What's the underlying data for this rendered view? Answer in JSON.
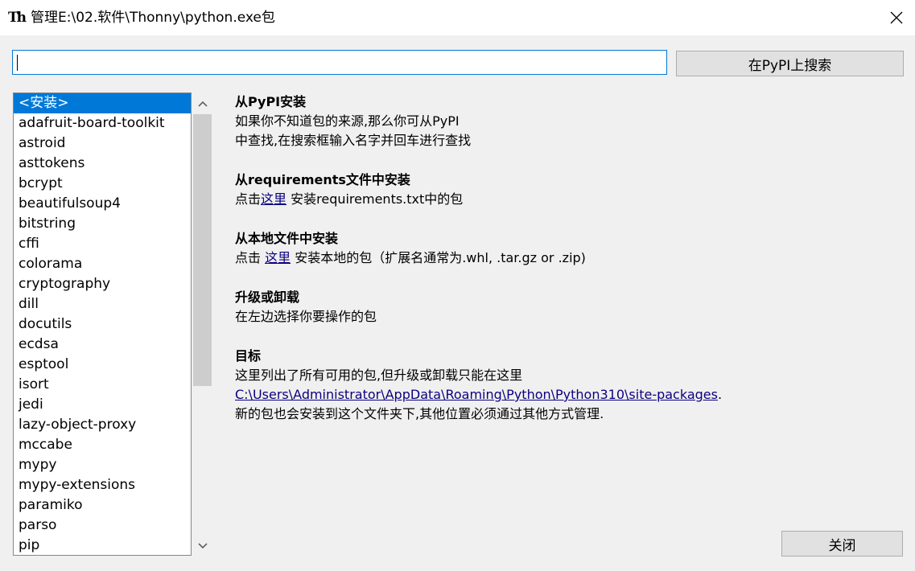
{
  "window": {
    "title": "管理E:\\02.软件\\Thonny\\python.exe包",
    "app_icon_text": "Th",
    "close_icon": "close-icon"
  },
  "search": {
    "value": "",
    "placeholder": "",
    "button_label": "在PyPI上搜索"
  },
  "packages": {
    "items": [
      "<安装>",
      "adafruit-board-toolkit",
      "astroid",
      "asttokens",
      "bcrypt",
      "beautifulsoup4",
      "bitstring",
      "cffi",
      "colorama",
      "cryptography",
      "dill",
      "docutils",
      "ecdsa",
      "esptool",
      "isort",
      "jedi",
      "lazy-object-proxy",
      "mccabe",
      "mypy",
      "mypy-extensions",
      "paramiko",
      "parso",
      "pip"
    ],
    "selected_index": 0
  },
  "info": {
    "pypi": {
      "title": "从PyPI安装",
      "line1": "如果你不知道包的来源,那么你可从PyPI",
      "line2": "中查找,在搜索框输入名字并回车进行查找"
    },
    "requirements": {
      "title": "从requirements文件中安装",
      "prefix": "点击",
      "link": "这里",
      "suffix": " 安装requirements.txt中的包"
    },
    "local": {
      "title": "从本地文件中安装",
      "prefix": "点击 ",
      "link": "这里",
      "suffix": " 安装本地的包（扩展名通常为.whl, .tar.gz or .zip)"
    },
    "upgrade": {
      "title": "升级或卸载",
      "line1": "在左边选择你要操作的包"
    },
    "target": {
      "title": "目标",
      "line1": "这里列出了所有可用的包,但升级或卸载只能在这里",
      "path_link": "C:\\Users\\Administrator\\AppData\\Roaming\\Python\\Python310\\site-packages",
      "path_suffix": ".",
      "line3": "新的包也会安装到这个文件夹下,其他位置必须通过其他方式管理."
    }
  },
  "footer": {
    "close_label": "关闭"
  },
  "colors": {
    "accent": "#0078d7",
    "background": "#f0f0f0",
    "link": "#0b0080"
  }
}
